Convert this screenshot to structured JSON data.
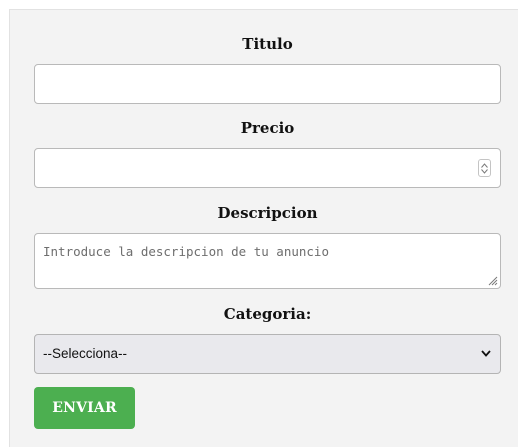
{
  "form": {
    "titulo_label": "Titulo",
    "titulo_value": "",
    "precio_label": "Precio",
    "precio_value": "",
    "descripcion_label": "Descripcion",
    "descripcion_placeholder": "Introduce la descripcion de tu anuncio",
    "categoria_label": "Categoria:",
    "categoria_selected": "--Selecciona--",
    "submit_label": "ENVIAR"
  },
  "colors": {
    "submit_background": "#4caf50",
    "panel_background": "#f3f3f3"
  },
  "icons": {
    "number_spinner": "up-down-spinner-icon",
    "textarea_resize": "resize-handle-icon",
    "select_dropdown": "chevron-down-icon"
  }
}
